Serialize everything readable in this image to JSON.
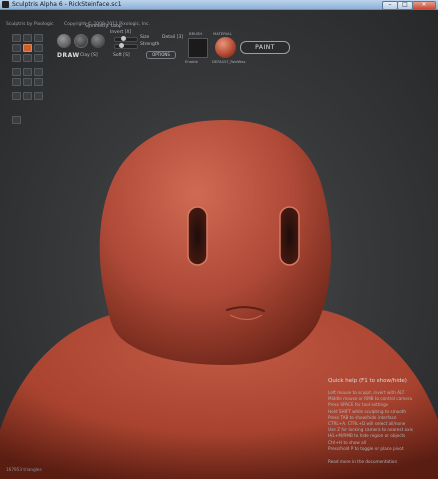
{
  "window": {
    "title": "Sculptris Alpha 6 - RickSteinface.sc1",
    "min_label": "–",
    "max_label": "□",
    "close_label": "✕"
  },
  "toolbar": {
    "app_info": "Sculptris by Pixologic",
    "copyright": "Copyright © 2009-2011 Pixologic, Inc.",
    "symmetry_label": "Symmetry: Loop",
    "invert_label": "Invert [X]",
    "size_label": "Size",
    "detail_label": "Detail [3]",
    "strength_label": "Strength",
    "options_label": "OPTIONS",
    "draw_label": "DRAW",
    "clay_label": "Clay [S]",
    "soft_label": "Soft [S]",
    "brush_label": "BRUSH",
    "material_label": "MATERIAL",
    "material_name": "DEFAULT_RedWax",
    "enable_label": "Enable",
    "paint_label": "PAINT",
    "size_value": 0.35,
    "strength_value": 0.25
  },
  "help": {
    "title": "Quick help (F1 to show/hide)",
    "lines": [
      "Left mouse to sculpt, invert with ALT",
      "Middle mouse or RMB to control camera",
      "Press SPACE for tool settings",
      "Hold SHIFT while sculpting to smooth",
      "Press TAB to show/hide interface",
      "CTRL+A, CTRL+D will select all/none",
      "Use Z for locking camera to nearest axis",
      "H/L+M/RMB to hide region or objects",
      "Ctrl+H to show all",
      "Press/hold P to toggle or place pivot"
    ],
    "more": "Read more in the documentation"
  },
  "status": {
    "triangles": "167953 triangles"
  },
  "colors": {
    "accent": "#c9602e",
    "model_base": "#b54c3a"
  },
  "icons": {
    "tool_grid": [
      "draw-icon",
      "flatten-icon",
      "crease-icon",
      "inflate-icon",
      "pinch-icon",
      "grab-icon",
      "smooth-icon",
      "rotate-icon",
      "scale-icon",
      "mask-icon",
      "reduce-icon",
      "subdivide-icon",
      "new-icon",
      "open-icon",
      "save-icon",
      "import-icon",
      "export-icon",
      "settings-icon",
      "help-icon"
    ]
  }
}
